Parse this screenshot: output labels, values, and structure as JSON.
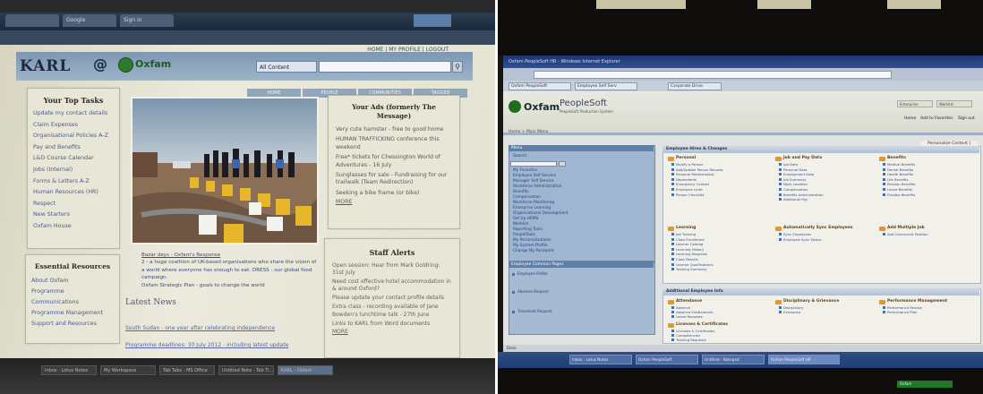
{
  "left_screen": {
    "browser_tabs": [
      "",
      "Google",
      "Sign in"
    ],
    "top_nav": "HOME | MY PROFILE | LOGOUT",
    "logo_text": "KARL",
    "at_symbol": "@",
    "partner_logo": "Oxfam",
    "search_select": "All Content",
    "nav_tabs": [
      "HOME",
      "PEOPLE",
      "COMMUNITIES",
      "TAGGED"
    ],
    "top_tasks": {
      "title": "Your Top Tasks",
      "links": [
        "Update my contact details",
        "Claim Expenses",
        "Organisational Policies A-Z",
        "Pay and Benefits",
        "L&D Course Calendar",
        "Jobs (Internal)",
        "Forms & Letters A-Z",
        "Human Resources (HR)",
        "Respect",
        "New Starters",
        "Oxfam House"
      ]
    },
    "essential_resources": {
      "title": "Essential Resources",
      "links": [
        "About Oxfam",
        "Programme",
        "Communications",
        "Programme Management",
        "Support and Resources"
      ]
    },
    "feature_captions": [
      "Bazar days - Oxfam's Response",
      "2 - a huge coalition of UK-based organisations who share the vision of a world where everyone has enough to eat. DRESS - our global food campaign.",
      "Oxfam Strategic Plan - goals to change the world"
    ],
    "latest_news": {
      "title": "Latest News",
      "items": [
        "South Sudan - one year after celebrating independence",
        "Programme deadlines: 30 July 2012 - including latest update"
      ]
    },
    "ads": {
      "title": "Your Ads (formerly The Message)",
      "items": [
        "Very cute hamster - free to good home",
        "HUMAN TRAFFICKING conference this weekend",
        "Free* tickets for Chessington World of Adventures - 16 July",
        "Sunglasses for sale - Fundraising for our trailwalk (Team Redirection)",
        "Seeking a bike frame (or bike)"
      ],
      "more": "MORE"
    },
    "alerts": {
      "title": "Staff Alerts",
      "items": [
        "Open session: Hear from Mark Goldring: 31st July",
        "Need cost effective hotel accommodation in & around Oxford?",
        "Please update your contact profile details",
        "Extra class - recording available of Jane Bowden's lunchtime talk - 27th June",
        "Links to KARL from Word documents"
      ],
      "more": "MORE"
    },
    "taskbar_items": [
      "Inbox - Lotus Notes",
      "My Workspace",
      "Tab Tabs - MS Office",
      "Untitled Note - Tab Ti...",
      "KARL - Oxfam"
    ]
  },
  "right_screen": {
    "window_title": "Oxfam PeopleSoft HR - Windows Internet Explorer",
    "browser_tabs": [
      "Oxfam PeopleSoft",
      "Employee Self Serv",
      "Corporate Drive"
    ],
    "logo_text": "Oxfam",
    "product": "PeopleSoft",
    "product_sub": "PeopleSoft Production System",
    "header_buttons": [
      "Enterprise",
      "Worklist"
    ],
    "header_links": [
      "Home",
      "Add to Favorites",
      "Sign out"
    ],
    "breadcrumb": "Home > Main Menu",
    "personalize": "Personalize Content | Layout",
    "menu": {
      "title": "Menu",
      "search_label": "Search:",
      "items": [
        "My Favorites",
        "Employee Self Service",
        "Manager Self Service",
        "Workforce Administration",
        "Benefits",
        "Compensation",
        "Workforce Monitoring",
        "Enterprise Learning",
        "Organisational Development",
        "Set Up HRMS",
        "Worklist",
        "Reporting Tools",
        "PeopleTools",
        "My Personalizations",
        "My System Profile",
        "Change My Password"
      ]
    },
    "common_pages": {
      "title": "Employee Common Pages",
      "items": [
        "Employee Profile",
        "Absence Request",
        "Timesheet Request"
      ]
    },
    "main_panel": "Employee Hires & Changes",
    "groups": [
      {
        "title": "Personal",
        "items": [
          "Modify a Person",
          "Add/Update Person Records",
          "Personal Relationships",
          "Dependents",
          "Emergency Contact",
          "Employee Links",
          "Person Checklist"
        ]
      },
      {
        "title": "Job and Pay Data",
        "items": [
          "Job Data",
          "Personal Data",
          "Employment Data",
          "Job Summary",
          "Work Location",
          "Compensation",
          "Benefits Administration",
          "Additional Pay"
        ]
      },
      {
        "title": "Benefits",
        "items": [
          "Medical Benefits",
          "Dental Benefits",
          "Health Benefits",
          "Life Benefits",
          "Pension Benefits",
          "Leave Benefits",
          "Flexible Benefits"
        ]
      },
      {
        "title": "Learning",
        "items": [
          "Job Training",
          "Class Enrollment",
          "Learner Catalog",
          "Learning History",
          "Learning Requests",
          "Class Results",
          "Learner Qualifications",
          "Training Summary"
        ]
      },
      {
        "title": "Automatically Sync Employees",
        "items": [
          "Sync Employees",
          "Employee Sync Status"
        ]
      },
      {
        "title": "Add Multiple Job",
        "items": [
          "Add Concurrent Position"
        ]
      }
    ],
    "additional_panel": "Additional Employee Info",
    "additional_groups": [
      {
        "title": "Attendance",
        "items": [
          "Absence",
          "Absence Entitlements",
          "Leave Requests"
        ]
      },
      {
        "title": "Disciplinary & Grievance",
        "items": [
          "Disciplinary",
          "Grievance"
        ]
      },
      {
        "title": "Performance Management",
        "items": [
          "Performance Review",
          "Performance Plan"
        ]
      },
      {
        "title": "Licenses & Certificates",
        "items": [
          "Licenses & Certificates",
          "Competencies",
          "Training Requests"
        ]
      }
    ],
    "status_bar": "Done",
    "taskbar_items": [
      "Inbox - Lotus Notes",
      "Oxfam PeopleSoft",
      "Untitled - Notepad",
      "Oxfam PeopleSoft HR"
    ],
    "led_label": "Oxfam"
  }
}
